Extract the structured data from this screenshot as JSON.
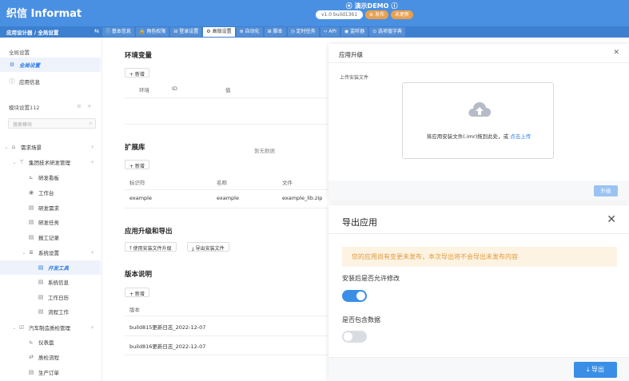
{
  "app": {
    "logo": "织信 Informat",
    "title": "演示DEMO",
    "version": "v1.0 build1361",
    "publish_label": "发布",
    "changes_label": "未更新"
  },
  "nav": {
    "breadcrumb": "应用设计器 / 全局设置",
    "tabs": [
      {
        "label": "基本信息",
        "icon": "info-icon"
      },
      {
        "label": "角色权限",
        "icon": "lock-icon"
      },
      {
        "label": "登录设置",
        "icon": "login-icon"
      },
      {
        "label": "高级设置",
        "icon": "gear-icon",
        "active": true
      },
      {
        "label": "自动化",
        "icon": "robot-icon"
      },
      {
        "label": "脚本",
        "icon": "script-icon"
      },
      {
        "label": "定时任务",
        "icon": "clock-icon"
      },
      {
        "label": "API",
        "icon": "code-icon"
      },
      {
        "label": "监听器",
        "icon": "listener-icon"
      },
      {
        "label": "选项值字典",
        "icon": "dict-icon"
      }
    ]
  },
  "sidebar": {
    "global_section": "全局设置",
    "global_items": [
      {
        "label": "全局设置",
        "icon": "gear-icon",
        "active": true
      },
      {
        "label": "应用信息",
        "icon": "info-icon"
      }
    ],
    "module_section": "模块设置112",
    "search_placeholder": "搜索模块",
    "tree": [
      {
        "label": "需求场景",
        "icon": "home-icon",
        "level": 0
      },
      {
        "label": "集团技术研发管理",
        "icon": "tree-icon",
        "level": 1
      },
      {
        "label": "研发看板",
        "icon": "chart-icon",
        "level": 2
      },
      {
        "label": "工作台",
        "icon": "circle-icon",
        "level": 2
      },
      {
        "label": "研发需求",
        "icon": "table-icon",
        "level": 2
      },
      {
        "label": "研发任务",
        "icon": "table-icon",
        "level": 2
      },
      {
        "label": "报工记录",
        "icon": "table-icon",
        "level": 2
      },
      {
        "label": "系统设置",
        "icon": "list-icon",
        "level": 2
      },
      {
        "label": "开发工具",
        "icon": "table-icon",
        "level": 3,
        "active": true
      },
      {
        "label": "系统信息",
        "icon": "table-icon",
        "level": 3
      },
      {
        "label": "工作日历",
        "icon": "table-icon",
        "level": 3
      },
      {
        "label": "流程工作",
        "icon": "table-icon",
        "level": 3
      },
      {
        "label": "汽车制造质检管理",
        "icon": "check-icon",
        "level": 1
      },
      {
        "label": "仪表盘",
        "icon": "chart-icon",
        "level": 2
      },
      {
        "label": "质检流程",
        "icon": "flow-icon",
        "level": 2
      },
      {
        "label": "生产订单",
        "icon": "table-icon",
        "level": 2
      }
    ]
  },
  "main": {
    "env": {
      "title": "环境变量",
      "add_label": "+ 新增",
      "columns": [
        "环境",
        "ID",
        "值"
      ],
      "empty_text": "暂无数据"
    },
    "ext": {
      "title": "扩展库",
      "add_label": "+ 新增",
      "columns": [
        "标识符",
        "名称",
        "文件"
      ],
      "rows": [
        [
          "example",
          "example",
          "example_lib.zip"
        ]
      ]
    },
    "upgrade": {
      "title": "应用升级和导出",
      "btn_upgrade": "使用安装文件升级",
      "btn_export": "导出安装文件"
    },
    "notes": {
      "title": "版本说明",
      "add_label": "+ 新增",
      "column": "版本",
      "rows": [
        "build815更新日志_2022-12-07",
        "build816更新日志_2022-12-07"
      ]
    }
  },
  "upgrade_dialog": {
    "title": "应用升级",
    "label": "上传安装文件",
    "hint": "将应用安装文件(.imr)拖到此处，或",
    "link": "点击上传",
    "submit": "升级"
  },
  "export_dialog": {
    "title": "导出应用",
    "warning": "您的应用尚有变更未发布，本次导出将不会导出未发布内容",
    "option1": "安装后是否允许修改",
    "option1_on": true,
    "option2": "是否包含数据",
    "option2_on": false,
    "submit": "导出"
  },
  "colors": {
    "brand": "#4A90E2",
    "primary": "#3A8EE6",
    "warning_bg": "#FDF3E3",
    "warning_text": "#E29B3B"
  }
}
